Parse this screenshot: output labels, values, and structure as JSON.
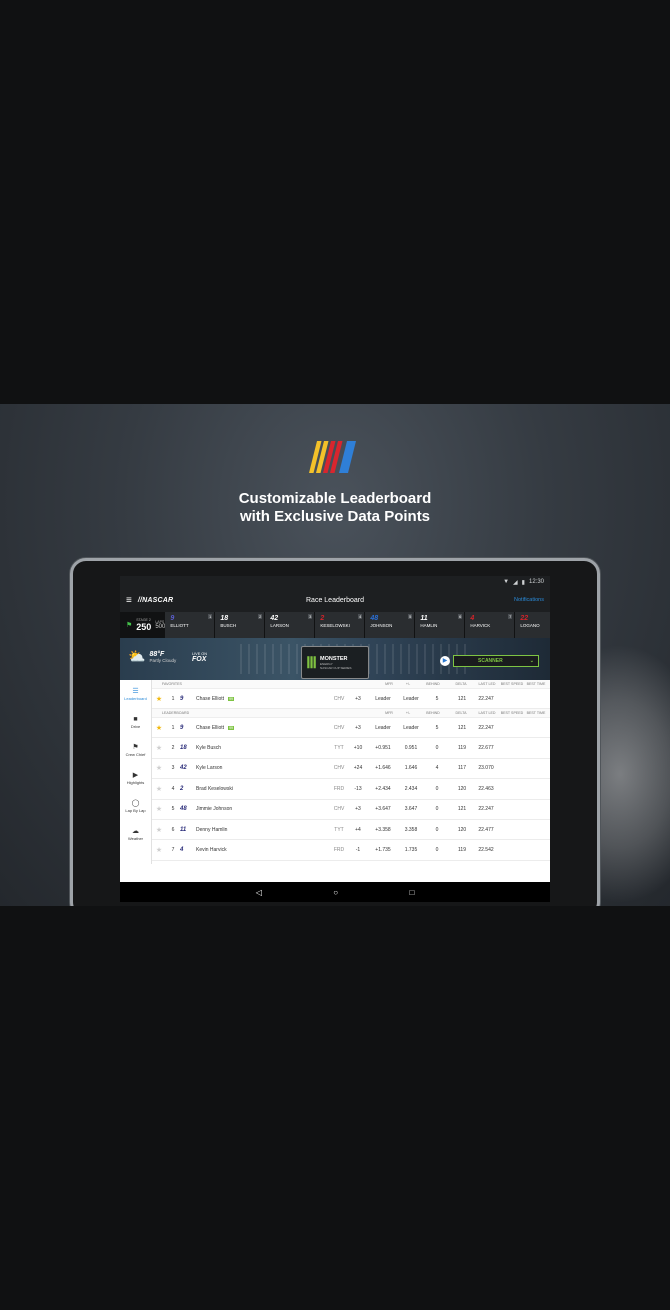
{
  "promo": {
    "headline_line1": "Customizable Leaderboard",
    "headline_line2": "with Exclusive Data Points",
    "stripe_colors": [
      "#f3c12a",
      "#f3c12a",
      "#d8262e",
      "#d8262e",
      "#2f7fd7"
    ]
  },
  "status": {
    "time": "12:30",
    "wifi": "▼",
    "signal": "◢",
    "battery": "▮"
  },
  "appbar": {
    "menu_icon": "≡",
    "brand": "//NASCAR",
    "title": "Race Leaderboard",
    "notifications": "Notifications"
  },
  "ticker": {
    "stage_label": "STAGE 2",
    "lap": "250",
    "laps_label": "LAPS",
    "total": "500",
    "drivers": [
      {
        "pos": "1",
        "num": "9",
        "name": "ELLIOTT",
        "color": "#5b5fd0"
      },
      {
        "pos": "2",
        "num": "18",
        "name": "BUSCH",
        "color": "#ffffff"
      },
      {
        "pos": "3",
        "num": "42",
        "name": "LARSON",
        "color": "#ffffff"
      },
      {
        "pos": "4",
        "num": "2",
        "name": "KESELOWSKI",
        "color": "#d2232a"
      },
      {
        "pos": "5",
        "num": "48",
        "name": "JOHNSON",
        "color": "#2a6fd6"
      },
      {
        "pos": "6",
        "num": "11",
        "name": "HAMLIN",
        "color": "#ffffff"
      },
      {
        "pos": "7",
        "num": "4",
        "name": "HARVICK",
        "color": "#d2232a"
      },
      {
        "pos": "",
        "num": "22",
        "name": "LOGANO",
        "color": "#d2232a"
      }
    ]
  },
  "hero": {
    "temp": "88°F",
    "condition": "Partly Cloudy",
    "live_on": "LIVE ON",
    "network": "FOX",
    "sponsor_line1": "MONSTER",
    "sponsor_line2": "ENERGY",
    "sponsor_line3": "NASCAR CUP SERIES",
    "scanner": "SCANNER"
  },
  "sidenav": [
    {
      "label": "Leaderboard",
      "icon": "☰",
      "active": true
    },
    {
      "label": "Drive",
      "icon": "■",
      "active": false
    },
    {
      "label": "Crew Chief",
      "icon": "⚑",
      "active": false
    },
    {
      "label": "Highlights",
      "icon": "▶",
      "active": false
    },
    {
      "label": "Lap By Lap",
      "icon": "◯",
      "active": false
    },
    {
      "label": "Weather",
      "icon": "☁",
      "active": false
    }
  ],
  "headers": {
    "favorites": "FAVORITES",
    "leaderboard": "LEADERBOARD",
    "cols": [
      "MFR",
      "+/-",
      "BEHIND",
      "DELTA",
      "LAST LED",
      "BEST SPEED",
      "BEST TIME"
    ]
  },
  "favorites": [
    {
      "pos": "1",
      "num": "9",
      "name": "Chase Elliott",
      "badge": "99",
      "mfr": "CHV",
      "pm": "+3",
      "behind": "Leader",
      "delta": "Leader",
      "led": "5",
      "speed": "121",
      "time": "22.247",
      "fav": true
    }
  ],
  "rows": [
    {
      "pos": "1",
      "num": "9",
      "name": "Chase Elliott",
      "badge": "99",
      "mfr": "CHV",
      "pm": "+3",
      "behind": "Leader",
      "delta": "Leader",
      "led": "5",
      "speed": "121",
      "time": "22.247",
      "fav": true
    },
    {
      "pos": "2",
      "num": "18",
      "name": "Kyle Busch",
      "badge": "",
      "mfr": "TYT",
      "pm": "+10",
      "behind": "+0.951",
      "delta": "0.951",
      "led": "0",
      "speed": "119",
      "time": "22.677",
      "fav": false
    },
    {
      "pos": "3",
      "num": "42",
      "name": "Kyle Larson",
      "badge": "",
      "mfr": "CHV",
      "pm": "+24",
      "behind": "+1.646",
      "delta": "1.646",
      "led": "4",
      "speed": "117",
      "time": "23.070",
      "fav": false
    },
    {
      "pos": "4",
      "num": "2",
      "name": "Brad Keselowski",
      "badge": "",
      "mfr": "FRD",
      "pm": "-13",
      "behind": "+2.434",
      "delta": "2.434",
      "led": "0",
      "speed": "120",
      "time": "22.463",
      "fav": false
    },
    {
      "pos": "5",
      "num": "48",
      "name": "Jimmie Johnson",
      "badge": "",
      "mfr": "CHV",
      "pm": "+3",
      "behind": "+3.647",
      "delta": "3.647",
      "led": "0",
      "speed": "121",
      "time": "22.247",
      "fav": false
    },
    {
      "pos": "6",
      "num": "11",
      "name": "Denny Hamlin",
      "badge": "",
      "mfr": "TYT",
      "pm": "+4",
      "behind": "+3.358",
      "delta": "3.358",
      "led": "0",
      "speed": "120",
      "time": "22.477",
      "fav": false
    },
    {
      "pos": "7",
      "num": "4",
      "name": "Kevin Harvick",
      "badge": "",
      "mfr": "FRD",
      "pm": "-1",
      "behind": "+1.735",
      "delta": "1.735",
      "led": "0",
      "speed": "119",
      "time": "22.542",
      "fav": false
    }
  ],
  "navbar": {
    "back": "◁",
    "home": "○",
    "recents": "□"
  }
}
